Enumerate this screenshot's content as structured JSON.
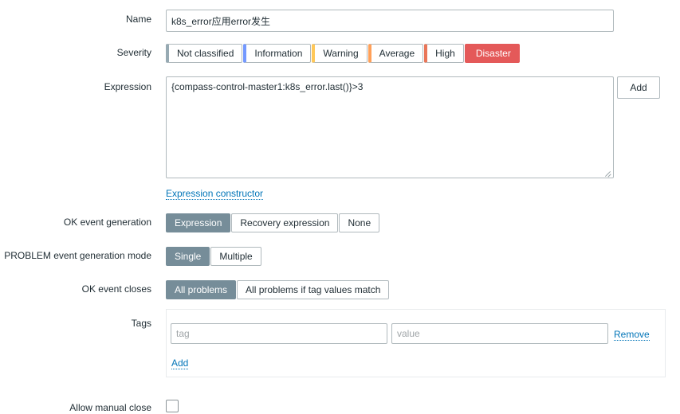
{
  "colors": {
    "selected_bg": "#768d99",
    "link": "#0275b8",
    "disaster_bg": "#e45959",
    "border": "#b0b9bd",
    "text": "#1f2c33",
    "tags_border": "#e8ebed",
    "sev_not_classified": "#97aab3",
    "sev_information": "#7499ff",
    "sev_warning": "#ffc859",
    "sev_average": "#ffa059",
    "sev_high": "#e97659",
    "sev_disaster": "#e45959"
  },
  "form": {
    "name": {
      "label": "Name",
      "value": "k8s_error应用error发生",
      "placeholder": ""
    },
    "severity": {
      "label": "Severity",
      "selected": "Disaster",
      "options": [
        {
          "label": "Not classified",
          "color": "#97aab3"
        },
        {
          "label": "Information",
          "color": "#7499ff"
        },
        {
          "label": "Warning",
          "color": "#ffc859"
        },
        {
          "label": "Average",
          "color": "#ffa059"
        },
        {
          "label": "High",
          "color": "#e97659"
        },
        {
          "label": "Disaster",
          "color": "#e45959"
        }
      ]
    },
    "expression": {
      "label": "Expression",
      "value": "{compass-control-master1:k8s_error.last()}>3",
      "add_button": "Add",
      "constructor_link": "Expression constructor"
    },
    "ok_event_generation": {
      "label": "OK event generation",
      "selected": "Expression",
      "options": [
        "Expression",
        "Recovery expression",
        "None"
      ]
    },
    "problem_event_generation_mode": {
      "label": "PROBLEM event generation mode",
      "selected": "Single",
      "options": [
        "Single",
        "Multiple"
      ]
    },
    "ok_event_closes": {
      "label": "OK event closes",
      "selected": "All problems",
      "options": [
        "All problems",
        "All problems if tag values match"
      ]
    },
    "tags": {
      "label": "Tags",
      "tag_placeholder": "tag",
      "tag_value": "",
      "value_placeholder": "value",
      "value_value": "",
      "remove_link": "Remove",
      "add_link": "Add"
    },
    "allow_manual_close": {
      "label": "Allow manual close",
      "checked": false
    }
  }
}
